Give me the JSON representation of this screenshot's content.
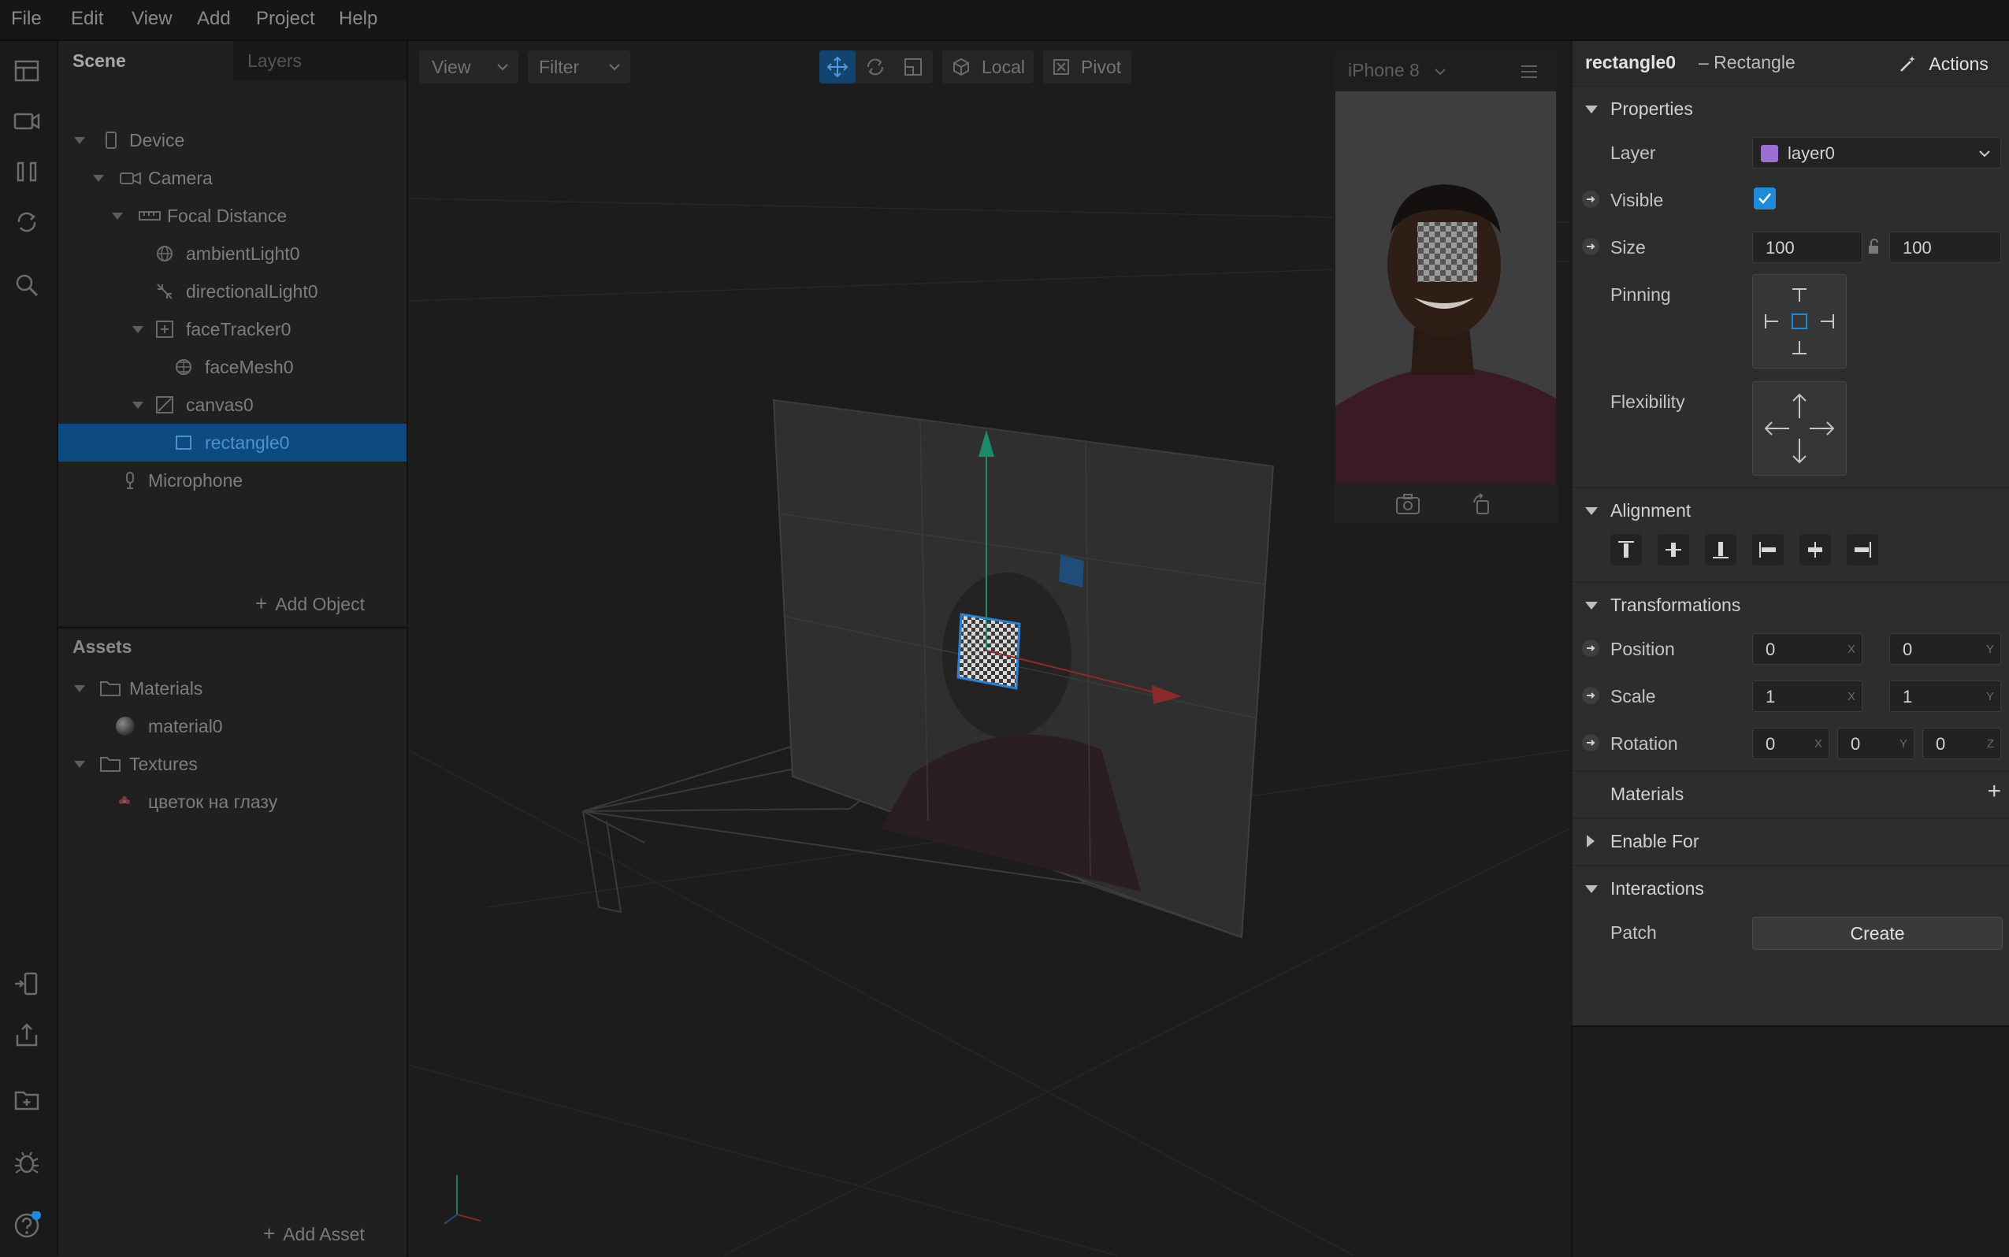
{
  "menu": [
    "File",
    "Edit",
    "View",
    "Add",
    "Project",
    "Help"
  ],
  "scene": {
    "tabs": [
      "Scene",
      "Layers"
    ],
    "tree": [
      {
        "label": "Device",
        "icon": "device-icon",
        "depth": 0
      },
      {
        "label": "Camera",
        "icon": "camera-icon",
        "depth": 1
      },
      {
        "label": "Focal Distance",
        "icon": "ruler-icon",
        "depth": 2
      },
      {
        "label": "ambientLight0",
        "icon": "globe-icon",
        "depth": 3
      },
      {
        "label": "directionalLight0",
        "icon": "directional-light-icon",
        "depth": 3
      },
      {
        "label": "faceTracker0",
        "icon": "face-tracker-icon",
        "depth": 3
      },
      {
        "label": "faceMesh0",
        "icon": "mesh-icon",
        "depth": 4
      },
      {
        "label": "canvas0",
        "icon": "canvas-icon",
        "depth": 3
      },
      {
        "label": "rectangle0",
        "icon": "rectangle-icon",
        "depth": 4
      },
      {
        "label": "Microphone",
        "icon": "microphone-icon",
        "depth": 1
      }
    ],
    "add_object": "Add Object"
  },
  "assets": {
    "title": "Assets",
    "folders": [
      {
        "label": "Materials",
        "items": [
          "material0"
        ]
      },
      {
        "label": "Textures",
        "items": [
          "цветок на глазу"
        ]
      }
    ],
    "add_asset": "Add Asset"
  },
  "viewport": {
    "view_label": "View",
    "filter_label": "Filter",
    "local_label": "Local",
    "pivot_label": "Pivot",
    "device_label": "iPhone 8"
  },
  "inspector": {
    "object_name": "rectangle0",
    "object_type": "– Rectangle",
    "actions_label": "Actions",
    "properties": {
      "title": "Properties",
      "layer_label": "Layer",
      "layer_value": "layer0",
      "layer_color": "#9b6fd6",
      "visible_label": "Visible",
      "visible_checked": true,
      "size_label": "Size",
      "size_w": "100",
      "size_h": "100",
      "pinning_label": "Pinning",
      "flexibility_label": "Flexibility"
    },
    "alignment": {
      "title": "Alignment"
    },
    "transformations": {
      "title": "Transformations",
      "position_label": "Position",
      "position": {
        "x": "0",
        "y": "0"
      },
      "scale_label": "Scale",
      "scale": {
        "x": "1",
        "y": "1"
      },
      "rotation_label": "Rotation",
      "rotation": {
        "x": "0",
        "y": "0",
        "z": "0"
      },
      "axes": {
        "x": "X",
        "y": "Y",
        "z": "Z"
      }
    },
    "materials_label": "Materials",
    "enable_for_label": "Enable For",
    "interactions": {
      "title": "Interactions",
      "patch_label": "Patch",
      "create_label": "Create"
    }
  },
  "colors": {
    "accent": "#1e8ad8",
    "selection": "#0d4a80"
  }
}
